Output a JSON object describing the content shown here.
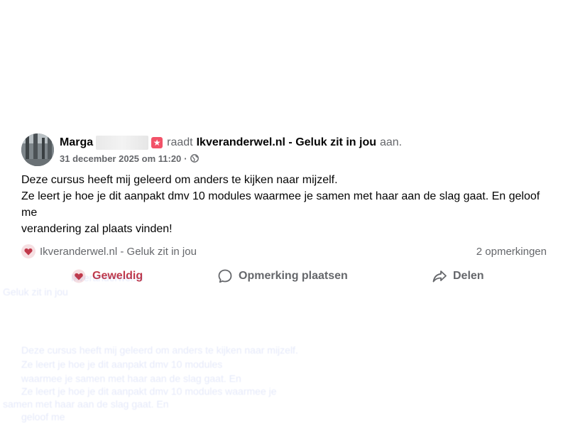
{
  "post": {
    "author_name": "Marga",
    "verb": "raadt",
    "page_name": "Ikveranderwel.nl - Geluk zit in jou",
    "suffix": "aan.",
    "timestamp": "31 december 2025 om 11:20",
    "separator": "·",
    "body_lines": [
      "Deze cursus heeft mij geleerd om anders te kijken naar mijzelf.",
      "Ze leert je hoe je dit aanpakt dmv 10 modules waarmee je samen met haar aan de slag gaat. En geloof me",
      "verandering zal plaats vinden!"
    ],
    "reaction_page": "Ikveranderwel.nl - Geluk zit in jou",
    "comments_count": "2 opmerkingen"
  },
  "actions": {
    "like_label": "Geweldig",
    "comment_label": "Opmerking plaatsen",
    "share_label": "Delen"
  },
  "colors": {
    "like_accent": "#c0394a",
    "recommend_badge": "#f25268",
    "muted_text": "#65676b"
  },
  "icons": {
    "recommend": "recommend-star-icon",
    "privacy": "globe-icon",
    "reaction": "heart-icon",
    "comment": "comment-bubble-icon",
    "share": "share-arrow-icon"
  },
  "ghost": {
    "lines": [
      "Ikveranderwel.nl",
      "Geluk zit in jou",
      "Deze cursus heeft mij geleerd om anders te kijken naar mijzelf.",
      "Ze leert je hoe je dit aanpakt dmv 10 modules",
      "waarmee je samen met haar aan de slag gaat. En",
      "Ze leert je hoe je dit aanpakt dmv 10 modules waarmee je",
      "samen met haar aan de slag gaat. En",
      "geloof me"
    ]
  }
}
